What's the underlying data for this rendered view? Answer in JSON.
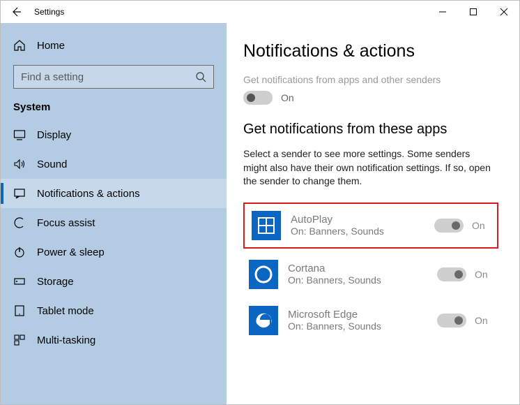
{
  "titlebar": {
    "title": "Settings"
  },
  "sidebar": {
    "home_label": "Home",
    "search_placeholder": "Find a setting",
    "section_label": "System",
    "items": [
      {
        "label": "Display"
      },
      {
        "label": "Sound"
      },
      {
        "label": "Notifications & actions"
      },
      {
        "label": "Focus assist"
      },
      {
        "label": "Power & sleep"
      },
      {
        "label": "Storage"
      },
      {
        "label": "Tablet mode"
      },
      {
        "label": "Multi-tasking"
      }
    ]
  },
  "main": {
    "title": "Notifications & actions",
    "global_desc": "Get notifications from apps and other senders",
    "global_toggle_label": "On",
    "apps_heading": "Get notifications from these apps",
    "apps_help": "Select a sender to see more settings. Some senders might also have their own notification settings. If so, open the sender to change them.",
    "apps": [
      {
        "name": "AutoPlay",
        "status": "On: Banners, Sounds",
        "toggle_label": "On"
      },
      {
        "name": "Cortana",
        "status": "On: Banners, Sounds",
        "toggle_label": "On"
      },
      {
        "name": "Microsoft Edge",
        "status": "On: Banners, Sounds",
        "toggle_label": "On"
      }
    ]
  }
}
